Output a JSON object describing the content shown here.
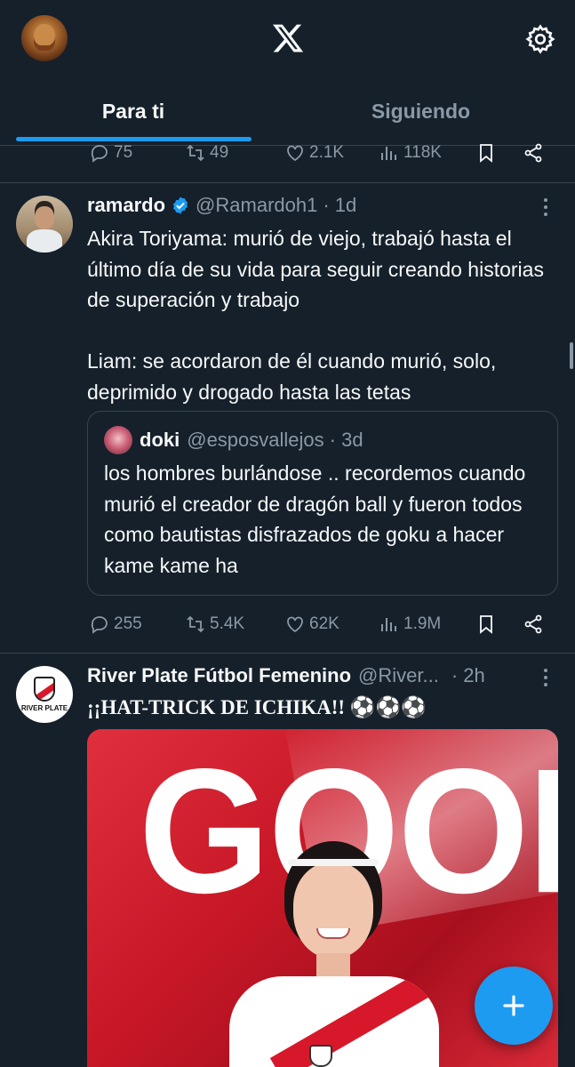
{
  "tabs": {
    "for_you": "Para ti",
    "following": "Siguiendo"
  },
  "prev_tweet_actions": {
    "replies": "75",
    "retweets": "49",
    "likes": "2.1K",
    "views": "118K"
  },
  "tweet1": {
    "name": "ramardo",
    "handle": "@Ramardoh1",
    "time": "· 1d",
    "text": "Akira Toriyama: murió de viejo, trabajó hasta el último día de su vida para seguir creando historias de superación y trabajo\n\nLiam: se acordaron de él cuando murió, solo, deprimido y drogado hasta las tetas",
    "quote": {
      "name": "doki",
      "handle": "@esposvallejos",
      "time": "· 3d",
      "text": "los hombres burlándose .. recordemos cuando murió el creador de dragón ball y fueron todos como bautistas disfrazados de goku a hacer kame kame ha"
    },
    "actions": {
      "replies": "255",
      "retweets": "5.4K",
      "likes": "62K",
      "views": "1.9M"
    }
  },
  "tweet2": {
    "name": "River Plate Fútbol Femenino",
    "handle": "@River...",
    "time": "· 2h",
    "text": "¡¡HAT-TRICK DE ICHIKA!! ⚽⚽⚽",
    "avatar_text": "RIVER PLATE",
    "media_text": "GOOL"
  },
  "colors": {
    "background": "#15202b",
    "accent": "#1d9bf0",
    "secondary_text": "#8b98a5",
    "border": "#38444d"
  }
}
